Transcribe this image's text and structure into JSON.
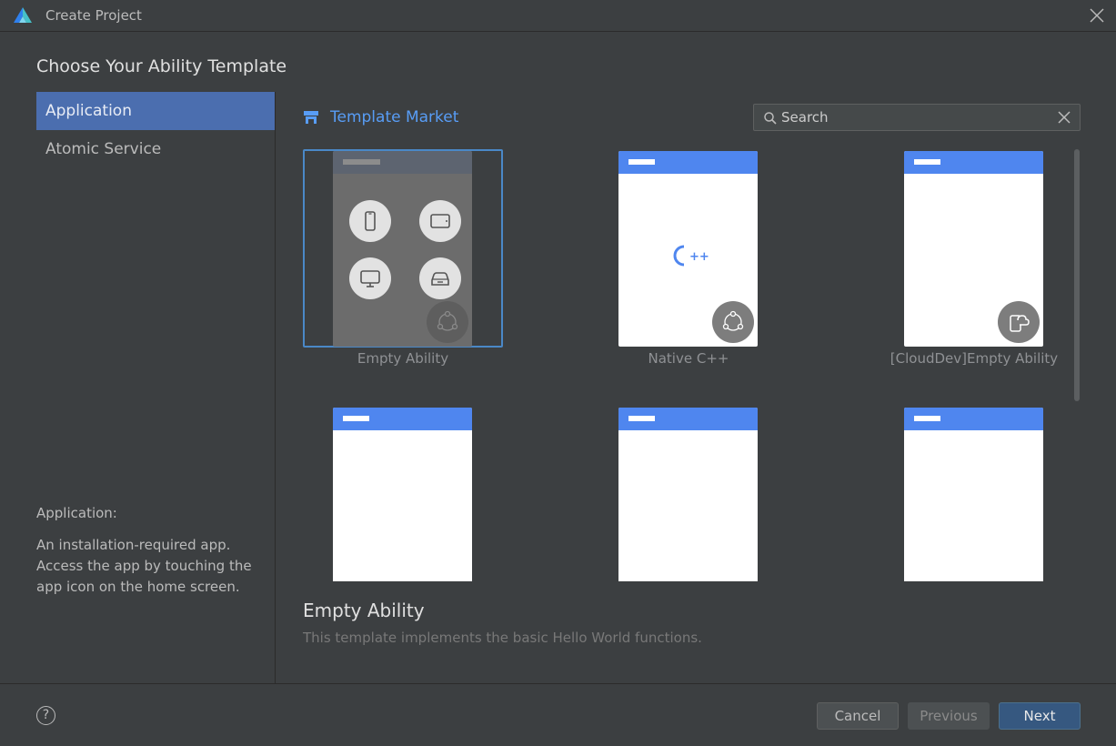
{
  "window": {
    "title": "Create Project"
  },
  "page": {
    "heading": "Choose Your Ability Template"
  },
  "sidebar": {
    "items": [
      {
        "label": "Application",
        "active": true
      },
      {
        "label": "Atomic Service",
        "active": false
      }
    ],
    "description_title": "Application:",
    "description_text": "An installation-required app. Access the app by touching the app icon on the home screen."
  },
  "market": {
    "label": "Template Market",
    "icon": "store-icon"
  },
  "search": {
    "placeholder": "Search",
    "value": ""
  },
  "templates": [
    {
      "label": "Empty Ability",
      "selected": true,
      "badge_icon": "atomic-cycle-icon"
    },
    {
      "label": "Native C++",
      "selected": false,
      "badge_icon": "atomic-cycle-icon"
    },
    {
      "label": "[CloudDev]Empty Ability",
      "selected": false,
      "badge_icon": "cloud-device-icon"
    },
    {
      "label": "",
      "selected": false,
      "badge_icon": "watch-icon"
    },
    {
      "label": "",
      "selected": false,
      "badge_icon": "multi-device-icon"
    },
    {
      "label": "",
      "selected": false,
      "badge_icon": "multi-device-icon"
    }
  ],
  "detail": {
    "title": "Empty Ability",
    "description": "This template implements the basic Hello World functions."
  },
  "footer": {
    "help_label": "?",
    "cancel_label": "Cancel",
    "previous_label": "Previous",
    "next_label": "Next"
  },
  "colors": {
    "background": "#3c3f41",
    "accent": "#4b6eaf",
    "link": "#589df6",
    "template_header": "#4f86ef",
    "primary_button": "#365880"
  }
}
